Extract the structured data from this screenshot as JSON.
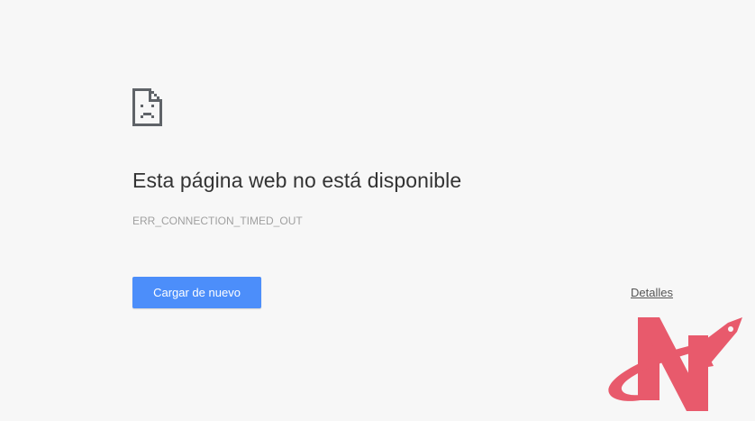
{
  "error_page": {
    "icon": "sad-page-icon",
    "title": "Esta página web no está disponible",
    "error_code": "ERR_CONNECTION_TIMED_OUT",
    "reload_button_label": "Cargar de nuevo",
    "details_link_label": "Detalles"
  },
  "watermark": {
    "icon": "rocket-n-logo",
    "color": "#e85a6c"
  },
  "colors": {
    "background": "#f7f7f7",
    "button": "#4c8efa",
    "title_text": "#333333",
    "error_code_text": "#a0a0a0"
  }
}
